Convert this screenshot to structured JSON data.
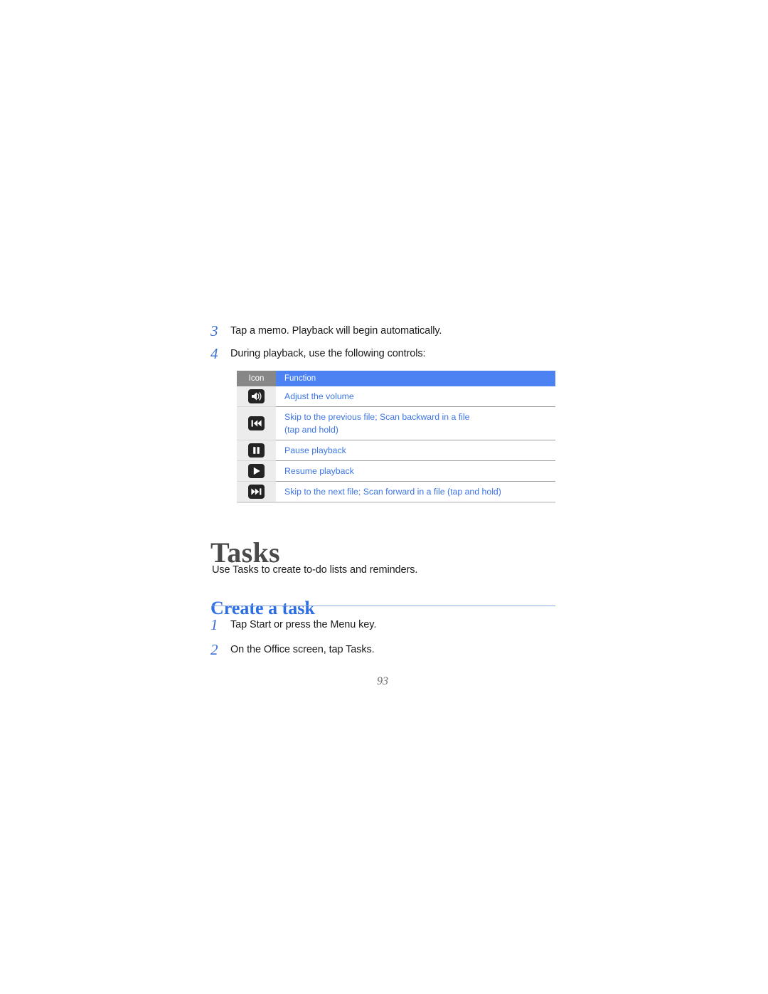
{
  "document": {
    "page_number": "93"
  },
  "steps_playback": [
    {
      "number": "3",
      "text": "Tap a memo. Playback will begin automatically."
    },
    {
      "number": "4",
      "text": "During playback, use the following controls:"
    }
  ],
  "controls_table": {
    "headers": {
      "icon": "Icon",
      "function": "Function"
    },
    "header_icon_bg": "#878787",
    "header_function_bg": "#4d82f3",
    "body_text_color": "#3b74e8",
    "rows": [
      {
        "icon_name": "volume-icon",
        "function_lines": [
          "Adjust the volume"
        ]
      },
      {
        "icon_name": "skip-previous-icon",
        "function_lines": [
          "Skip to the previous file; Scan backward in a file",
          "(tap and hold)"
        ]
      },
      {
        "icon_name": "pause-icon",
        "function_lines": [
          "Pause playback"
        ]
      },
      {
        "icon_name": "play-icon",
        "function_lines": [
          "Resume playback"
        ]
      },
      {
        "icon_name": "skip-next-icon",
        "function_lines": [
          "Skip to the next file; Scan forward in a file (tap and hold)"
        ]
      }
    ]
  },
  "tasks_section": {
    "heading": "Tasks",
    "intro": "Use Tasks to create to-do lists and reminders.",
    "subheading": "Create a task",
    "subheading_color": "#2f6fe4",
    "steps": [
      {
        "number": "1",
        "text": "Tap Start or press the Menu key."
      },
      {
        "number": "2",
        "text": "On the Office screen, tap Tasks."
      }
    ]
  }
}
